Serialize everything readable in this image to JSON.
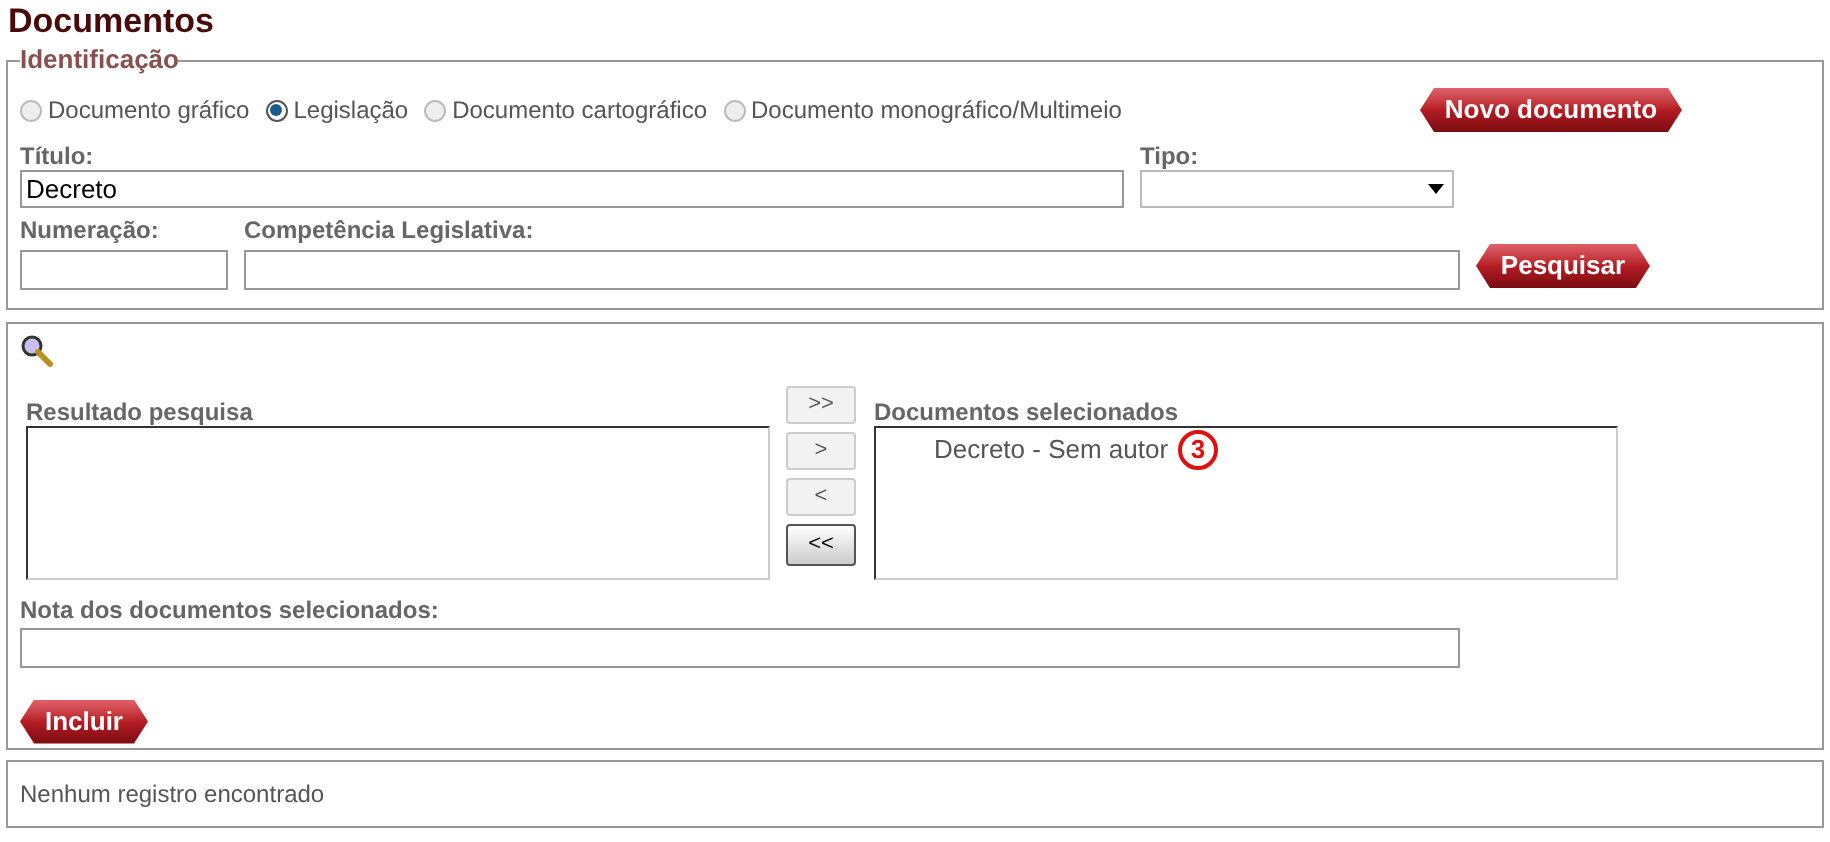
{
  "page_title": "Documentos",
  "identificacao": {
    "legend": "Identificação",
    "doc_types": [
      {
        "label": "Documento gráfico",
        "selected": false
      },
      {
        "label": "Legislação",
        "selected": true
      },
      {
        "label": "Documento cartográfico",
        "selected": false
      },
      {
        "label": "Documento monográfico/Multimeio",
        "selected": false
      }
    ],
    "new_button": "Novo documento",
    "titulo": {
      "label": "Título:",
      "value": "Decreto"
    },
    "tipo": {
      "label": "Tipo:"
    },
    "numeracao": {
      "label": "Numeração:"
    },
    "competencia": {
      "label": "Competência Legislativa:"
    },
    "search_button": "Pesquisar"
  },
  "selection": {
    "results_label": "Resultado pesquisa",
    "transfer_buttons": [
      {
        "label": ">>",
        "focused": false
      },
      {
        "label": ">",
        "focused": false
      },
      {
        "label": "<",
        "focused": false
      },
      {
        "label": "<<",
        "focused": true
      }
    ],
    "selected_label": "Documentos selecionados",
    "selected_items": [
      {
        "text": "Decreto - Sem autor",
        "marker": "3"
      }
    ],
    "note": {
      "label": "Nota dos documentos selecionados:"
    },
    "include_button": "Incluir"
  },
  "status": "Nenhum registro encontrado"
}
